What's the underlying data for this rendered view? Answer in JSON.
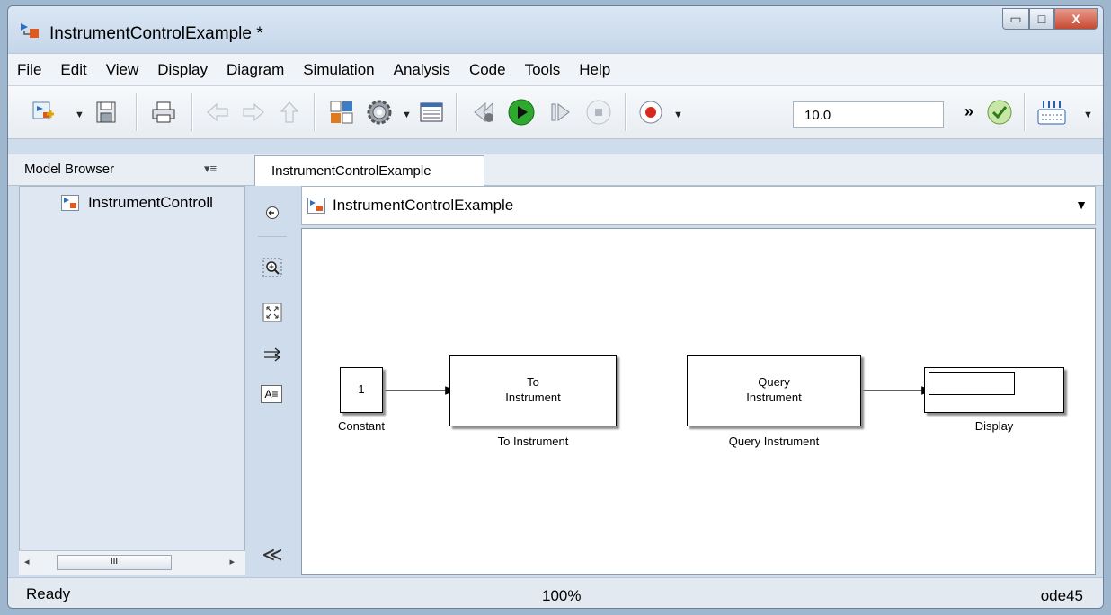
{
  "window": {
    "title": "InstrumentControlExample *",
    "minimize_glyph": "▭",
    "maximize_glyph": "□",
    "close_glyph": "X"
  },
  "menu": [
    "File",
    "Edit",
    "View",
    "Display",
    "Diagram",
    "Simulation",
    "Analysis",
    "Code",
    "Tools",
    "Help"
  ],
  "toolbar": {
    "stop_time": "10.0",
    "more_glyph": "»",
    "icons": [
      "new-model-icon",
      "save-icon",
      "print-icon",
      "back-icon",
      "forward-icon",
      "up-icon",
      "library-browser-icon",
      "model-config-icon",
      "model-explorer-icon",
      "step-back-icon",
      "run-icon",
      "step-forward-icon",
      "stop-icon",
      "record-icon",
      "check-icon",
      "build-icon"
    ]
  },
  "model_browser": {
    "title": "Model Browser",
    "menu_glyph": "▾≡",
    "item": "InstrumentControll",
    "scroll_thumb": "III",
    "scroll_left": "◂",
    "scroll_right": "▸"
  },
  "tab": {
    "label": "InstrumentControlExample"
  },
  "address": {
    "path": "InstrumentControlExample",
    "dropdown_glyph": "▼"
  },
  "palette": {
    "collapse_glyph": "≪",
    "annotation_glyph": "A≡"
  },
  "diagram": {
    "blocks": {
      "constant": {
        "content": "1",
        "label": "Constant"
      },
      "to_instrument": {
        "line1": "To",
        "line2": "Instrument",
        "label": "To Instrument"
      },
      "query_instrument": {
        "line1": "Query",
        "line2": "Instrument",
        "label": "Query Instrument"
      },
      "display": {
        "label": "Display"
      }
    }
  },
  "status": {
    "left": "Ready",
    "zoom": "100%",
    "solver": "ode45"
  },
  "colors": {
    "run_green": "#2ea82e",
    "record_red": "#d8281e",
    "title_bg": "#cfdceb"
  }
}
